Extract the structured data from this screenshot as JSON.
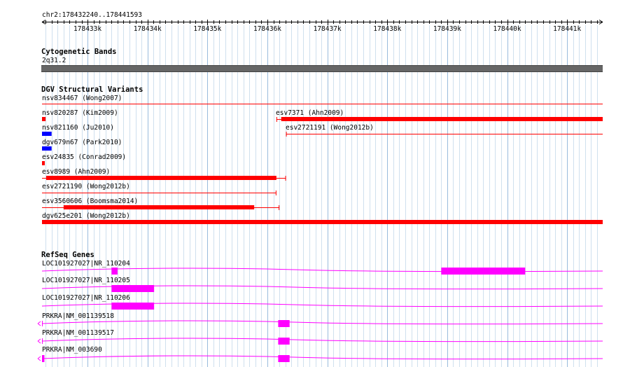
{
  "ruler": {
    "range_label": "chr2:178432240..178441593",
    "start": 178432240,
    "end": 178441593,
    "ticks": [
      "178433k",
      "178434k",
      "178435k",
      "178436k",
      "178437k",
      "178438k",
      "178439k",
      "178440k",
      "178441k"
    ],
    "tick_values": [
      178433000,
      178434000,
      178435000,
      178436000,
      178437000,
      178438000,
      178439000,
      178440000,
      178441000
    ]
  },
  "cyto": {
    "title": "Cytogenetic Bands",
    "band_label": "2q31.2",
    "band_color": "#666666"
  },
  "dgv": {
    "title": "DGV Structural Variants",
    "color": "#ff0000",
    "gain_color": "#0000ff",
    "features": [
      {
        "label": "nsv834467 (Wong2007)",
        "start": 178432240,
        "end": 178441593,
        "style": "line"
      },
      {
        "label": "nsv820287 (Kim2009)",
        "start": 178432240,
        "end": 178432300,
        "style": "box"
      },
      {
        "label": "esv7371 (Ahn2009)",
        "start": 178436150,
        "end": 178441593,
        "style": "bar",
        "thick_start": 178436230
      },
      {
        "label": "nsv821160 (Ju2010)",
        "start": 178432240,
        "end": 178432400,
        "style": "gain"
      },
      {
        "label": "esv2721191 (Wong2012b)",
        "start": 178436310,
        "end": 178441593,
        "style": "line"
      },
      {
        "label": "dgv679n67 (Park2010)",
        "start": 178432240,
        "end": 178432400,
        "style": "gain"
      },
      {
        "label": "esv24835 (Conrad2009)",
        "start": 178432240,
        "end": 178432280,
        "style": "box"
      },
      {
        "label": "esv8989 (Ahn2009)",
        "start": 178432240,
        "end": 178436310,
        "style": "bar",
        "thick_start": 178432310,
        "thick_end": 178436150
      },
      {
        "label": "esv2721190 (Wong2012b)",
        "start": 178432240,
        "end": 178436150,
        "style": "line"
      },
      {
        "label": "esv3560606 (Boomsma2014)",
        "start": 178432240,
        "end": 178436200,
        "style": "bar",
        "thick_start": 178432600,
        "thick_end": 178435780
      },
      {
        "label": "dgv625e201 (Wong2012b)",
        "start": 178432240,
        "end": 178441593,
        "style": "full"
      }
    ]
  },
  "refseq": {
    "title": "RefSeq Genes",
    "color": "#ff00ff",
    "genes": [
      {
        "label": "LOC101927027|NR_110204",
        "exons": [
          [
            178433400,
            178433500
          ],
          [
            178438900,
            178440300
          ]
        ]
      },
      {
        "label": "LOC101927027|NR_110205",
        "exons": [
          [
            178433400,
            178434110
          ]
        ]
      },
      {
        "label": "LOC101927027|NR_110206",
        "exons": [
          [
            178433400,
            178434110
          ]
        ]
      },
      {
        "label": "PRKRA|NM_001139518",
        "exons": [
          [
            178436180,
            178436370
          ]
        ],
        "arrow": "left"
      },
      {
        "label": "PRKRA|NM_001139517",
        "exons": [
          [
            178436180,
            178436370
          ]
        ],
        "arrow": "left"
      },
      {
        "label": "PRKRA|NM_003690",
        "exons": [
          [
            178432240,
            178432280
          ],
          [
            178436180,
            178436370
          ]
        ],
        "arrow": "left"
      }
    ]
  }
}
